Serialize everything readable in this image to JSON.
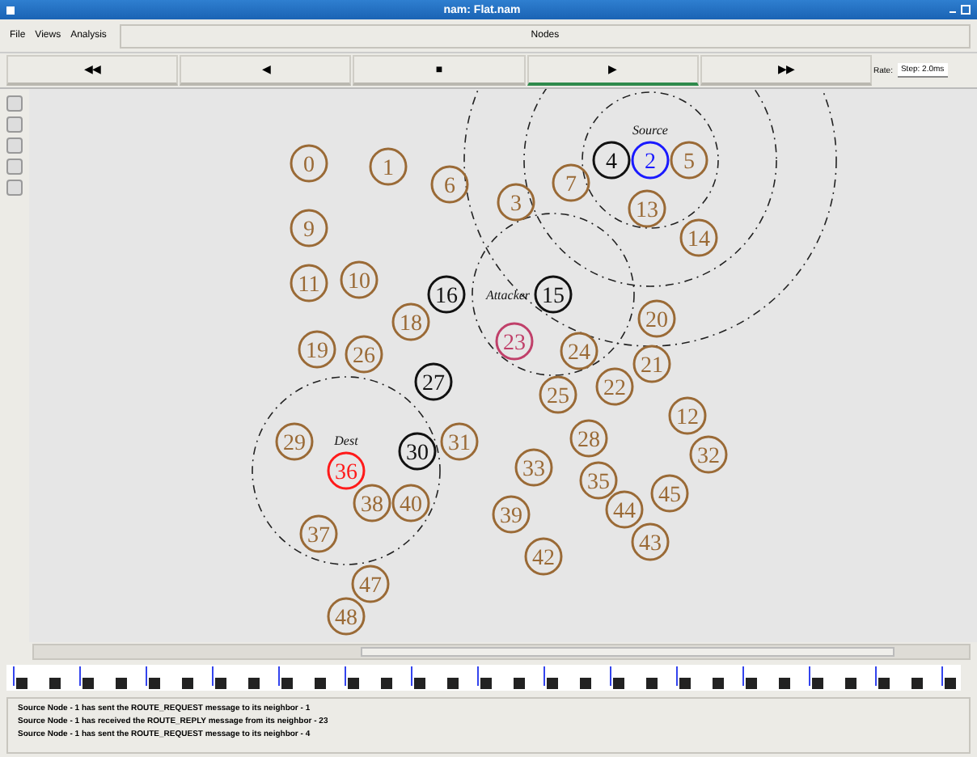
{
  "window": {
    "title": "nam: Flat.nam"
  },
  "menu": [
    "File",
    "Views",
    "Analysis"
  ],
  "status": "Nodes",
  "controls": [
    {
      "glyph": "◀◀",
      "selected": false
    },
    {
      "glyph": "◀",
      "selected": false
    },
    {
      "glyph": "■",
      "selected": false
    },
    {
      "glyph": "▶",
      "selected": true
    },
    {
      "glyph": "▶▶",
      "selected": false
    }
  ],
  "rate": {
    "label": "Rate:",
    "step": "Step: 2.0ms"
  },
  "nodes": [
    {
      "label": "0",
      "kind": "normal"
    },
    {
      "label": "1",
      "kind": "normal"
    },
    {
      "label": "4",
      "kind": "relay"
    },
    {
      "label": "2",
      "kind": "source",
      "caption": "Source"
    },
    {
      "label": "5",
      "kind": "normal"
    },
    {
      "label": "6",
      "kind": "normal"
    },
    {
      "label": "7",
      "kind": "normal"
    },
    {
      "label": "3",
      "kind": "normal"
    },
    {
      "label": "13",
      "kind": "normal"
    },
    {
      "label": "9",
      "kind": "normal"
    },
    {
      "label": "14",
      "kind": "normal"
    },
    {
      "label": "11",
      "kind": "normal"
    },
    {
      "label": "10",
      "kind": "normal"
    },
    {
      "label": "16",
      "kind": "relay"
    },
    {
      "label": "15",
      "kind": "malicious",
      "caption": "Attacker"
    },
    {
      "label": "18",
      "kind": "normal"
    },
    {
      "label": "20",
      "kind": "normal"
    },
    {
      "label": "19",
      "kind": "normal"
    },
    {
      "label": "26",
      "kind": "normal"
    },
    {
      "label": "23",
      "kind": "suspect"
    },
    {
      "label": "24",
      "kind": "normal"
    },
    {
      "label": "21",
      "kind": "normal"
    },
    {
      "label": "27",
      "kind": "relay"
    },
    {
      "label": "25",
      "kind": "normal"
    },
    {
      "label": "22",
      "kind": "normal"
    },
    {
      "label": "12",
      "kind": "normal"
    },
    {
      "label": "29",
      "kind": "normal"
    },
    {
      "label": "36",
      "kind": "destination",
      "caption": "Dest"
    },
    {
      "label": "30",
      "kind": "relay"
    },
    {
      "label": "31",
      "kind": "normal"
    },
    {
      "label": "33",
      "kind": "normal"
    },
    {
      "label": "28",
      "kind": "normal"
    },
    {
      "label": "35",
      "kind": "normal"
    },
    {
      "label": "32",
      "kind": "normal"
    },
    {
      "label": "38",
      "kind": "normal"
    },
    {
      "label": "40",
      "kind": "normal"
    },
    {
      "label": "39",
      "kind": "normal"
    },
    {
      "label": "44",
      "kind": "normal"
    },
    {
      "label": "45",
      "kind": "normal"
    },
    {
      "label": "37",
      "kind": "normal"
    },
    {
      "label": "42",
      "kind": "normal"
    },
    {
      "label": "43",
      "kind": "normal"
    },
    {
      "label": "47",
      "kind": "normal"
    },
    {
      "label": "48",
      "kind": "normal"
    }
  ],
  "log": [
    "Source Node - 1 has sent the ROUTE_REQUEST message to its neighbor - 1",
    "Source Node - 1 has received the ROUTE_REPLY message from its neighbor - 23",
    "Source Node - 1 has sent the ROUTE_REQUEST message to its neighbor - 4"
  ]
}
